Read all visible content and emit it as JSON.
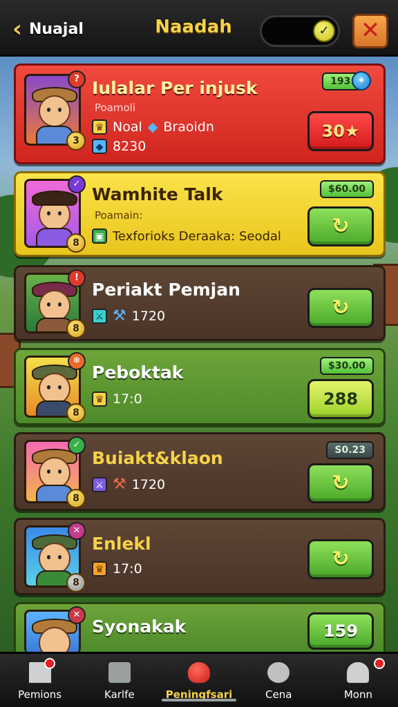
{
  "header": {
    "back_label": "Nuajal",
    "title": "Naadah",
    "toggle_state": "on"
  },
  "cards": [
    {
      "name": "Iulalar Per injusk",
      "sub": "Poamoli",
      "line1_text": "Noal",
      "line1_extra": "Braoidn",
      "line2_text": "8230",
      "tag": "193:",
      "button": "30★",
      "portrait_badge_top": "?",
      "portrait_badge_bottom": "3",
      "theme": "red"
    },
    {
      "name": "Wamhite Talk",
      "sub": "Poamain:",
      "line1_text": "Texforioks Deraaka: Seodal",
      "tag": "$60.00",
      "button_icon": "refresh-icon",
      "portrait_badge_top": "✓",
      "portrait_badge_bottom": "8",
      "theme": "yellow"
    },
    {
      "name": "Periakt Pemjan",
      "line1_text": "1720",
      "button_icon": "refresh-icon",
      "portrait_badge_top": "!",
      "portrait_badge_bottom": "8",
      "theme": "brown"
    },
    {
      "name": "Peboktak",
      "line1_text": "17:0",
      "tag": "$30.00",
      "button": "288",
      "portrait_badge_top": "❄",
      "portrait_badge_bottom": "8",
      "theme": "green"
    },
    {
      "name": "Buiakt&klaon",
      "line1_text": "1720",
      "tag": "S0.23",
      "button_icon": "refresh-icon",
      "portrait_badge_top": "✓",
      "portrait_badge_bottom": "8",
      "theme": "brown"
    },
    {
      "name": "Enlekl",
      "line1_text": "17:0",
      "button_icon": "refresh-icon",
      "portrait_badge_top": "✕",
      "portrait_badge_bottom": "8",
      "theme": "brown"
    },
    {
      "name": "Syonakak",
      "button": "159",
      "portrait_badge_top": "✕",
      "theme": "green"
    }
  ],
  "nav": [
    {
      "label": "Pemions",
      "icon": "home-icon",
      "notify": true
    },
    {
      "label": "Karlfe",
      "icon": "chest-icon",
      "notify": false
    },
    {
      "label": "Peningfsari",
      "icon": "gem-icon",
      "notify": false,
      "active": true
    },
    {
      "label": "Cena",
      "icon": "gear-icon",
      "notify": false
    },
    {
      "label": "Monn",
      "icon": "profile-icon",
      "notify": true
    }
  ],
  "colors": {
    "accent_yellow": "#f6d24a",
    "button_green": "#4aa82a",
    "button_red": "#d21a1a"
  }
}
